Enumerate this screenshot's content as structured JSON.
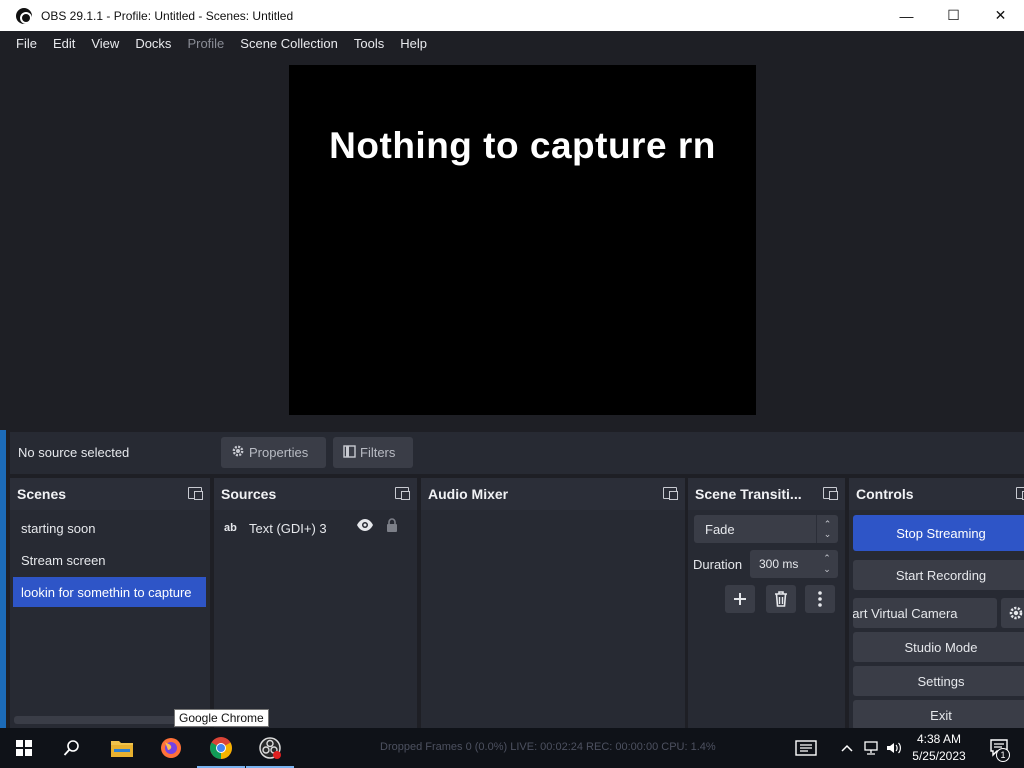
{
  "window": {
    "title": "OBS 29.1.1 - Profile: Untitled - Scenes: Untitled",
    "minimize": "—",
    "maximize": "☐",
    "close": "✕"
  },
  "menu": [
    "File",
    "Edit",
    "View",
    "Docks",
    "Profile",
    "Scene Collection",
    "Tools",
    "Help"
  ],
  "preview": {
    "text": "Nothing to capture rn"
  },
  "context_bar": {
    "status": "No source selected",
    "properties_label": "Properties",
    "filters_label": "Filters"
  },
  "docks": {
    "scenes": {
      "title": "Scenes",
      "items": [
        "starting soon",
        "Stream screen",
        "lookin for somethin to capture"
      ],
      "selected_index": 2
    },
    "sources": {
      "title": "Sources",
      "items": [
        {
          "type_icon": "ab",
          "label": "Text (GDI+) 3"
        }
      ]
    },
    "audio_mixer": {
      "title": "Audio Mixer"
    },
    "transitions": {
      "title": "Scene Transiti...",
      "selected": "Fade",
      "duration_label": "Duration",
      "duration_value": "300 ms"
    },
    "controls": {
      "title": "Controls",
      "buttons": [
        "Stop Streaming",
        "Start Recording",
        "Start Virtual Camera",
        "Studio Mode",
        "Settings",
        "Exit"
      ]
    }
  },
  "tooltip": "Google Chrome",
  "taskbar": {
    "status_text": "Dropped Frames 0 (0.0%)     LIVE: 00:02:24     REC: 00:00:00     CPU: 1.4%",
    "time": "4:38 AM",
    "date": "5/25/2023",
    "notification_count": "1"
  },
  "colors": {
    "accent": "#2e55c7",
    "panel": "#272a33",
    "background": "#1e1f25"
  }
}
